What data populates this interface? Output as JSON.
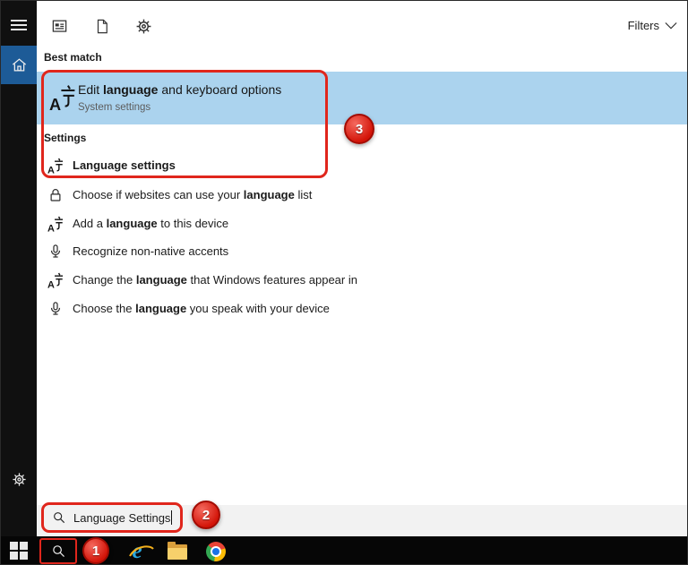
{
  "topbar": {
    "filters_label": "Filters",
    "icons": [
      "apps-filter",
      "documents-filter",
      "settings-filter"
    ]
  },
  "sidebar": {
    "items": [
      "menu",
      "home",
      "settings"
    ]
  },
  "sections": {
    "best_match_header": "Best match",
    "settings_header": "Settings"
  },
  "best_match": {
    "title_pre": "Edit ",
    "title_bold": "language",
    "title_post": " and keyboard options",
    "subtitle": "System settings"
  },
  "settings_item": {
    "label": "Language settings"
  },
  "results": [
    {
      "icon": "lock",
      "pre": "Choose if websites can use your ",
      "bold": "language",
      "post": " list"
    },
    {
      "icon": "language",
      "pre": "Add a ",
      "bold": "language",
      "post": " to this device"
    },
    {
      "icon": "mic",
      "pre": "Recognize non-native accents",
      "bold": "",
      "post": ""
    },
    {
      "icon": "language",
      "pre": "Change the ",
      "bold": "language",
      "post": " that Windows features appear in"
    },
    {
      "icon": "mic",
      "pre": "Choose the ",
      "bold": "language",
      "post": " you speak with your device"
    }
  ],
  "search": {
    "value": "Language Settings"
  },
  "annotations": {
    "step1": "1",
    "step2": "2",
    "step3": "3",
    "color": "#e0261c"
  },
  "colors": {
    "highlight_blue": "#abd3ee",
    "sidebar_home_blue": "#1d5b97",
    "annotation_red": "#e0261c",
    "search_strip_gray": "#f2f2f2"
  }
}
